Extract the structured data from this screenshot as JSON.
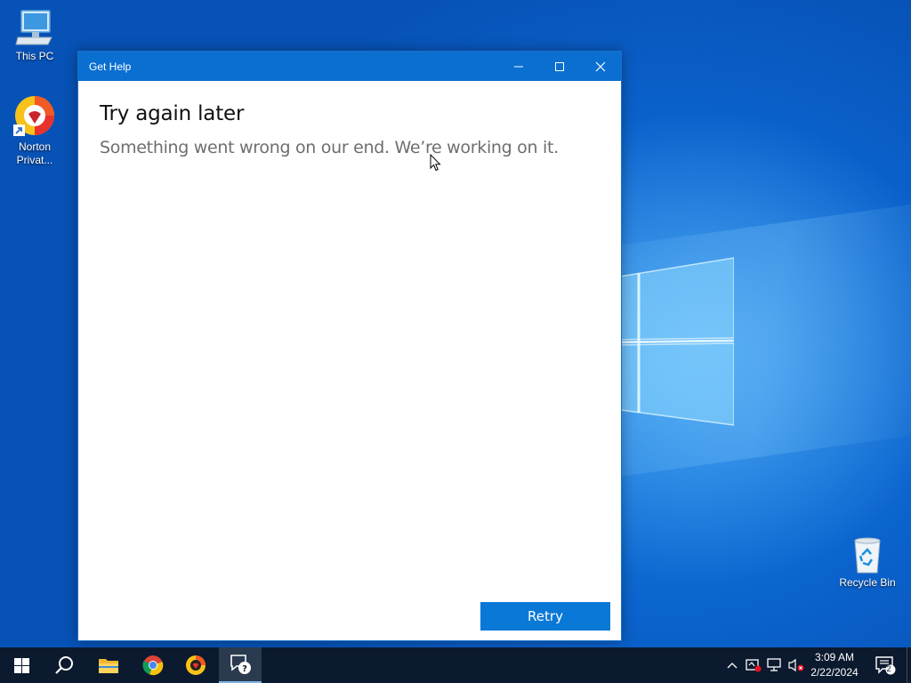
{
  "desktop": {
    "icons": [
      {
        "label": "This PC"
      },
      {
        "label": "Norton Privat..."
      },
      {
        "label": "Recycle Bin"
      }
    ]
  },
  "window": {
    "title": "Get Help",
    "heading": "Try again later",
    "message": "Something went wrong on our end. We’re working on it.",
    "retry_label": "Retry"
  },
  "taskbar": {
    "items": [
      "start-icon",
      "search-icon",
      "file-explorer-icon",
      "chrome-icon",
      "norton-icon",
      "get-help-icon"
    ],
    "time": "3:09 AM",
    "date": "2/22/2024",
    "notification_count": "2"
  },
  "colors": {
    "accent": "#0a78d7",
    "titlebar": "#0a6fd0",
    "taskbar": "#0b1a2e"
  }
}
